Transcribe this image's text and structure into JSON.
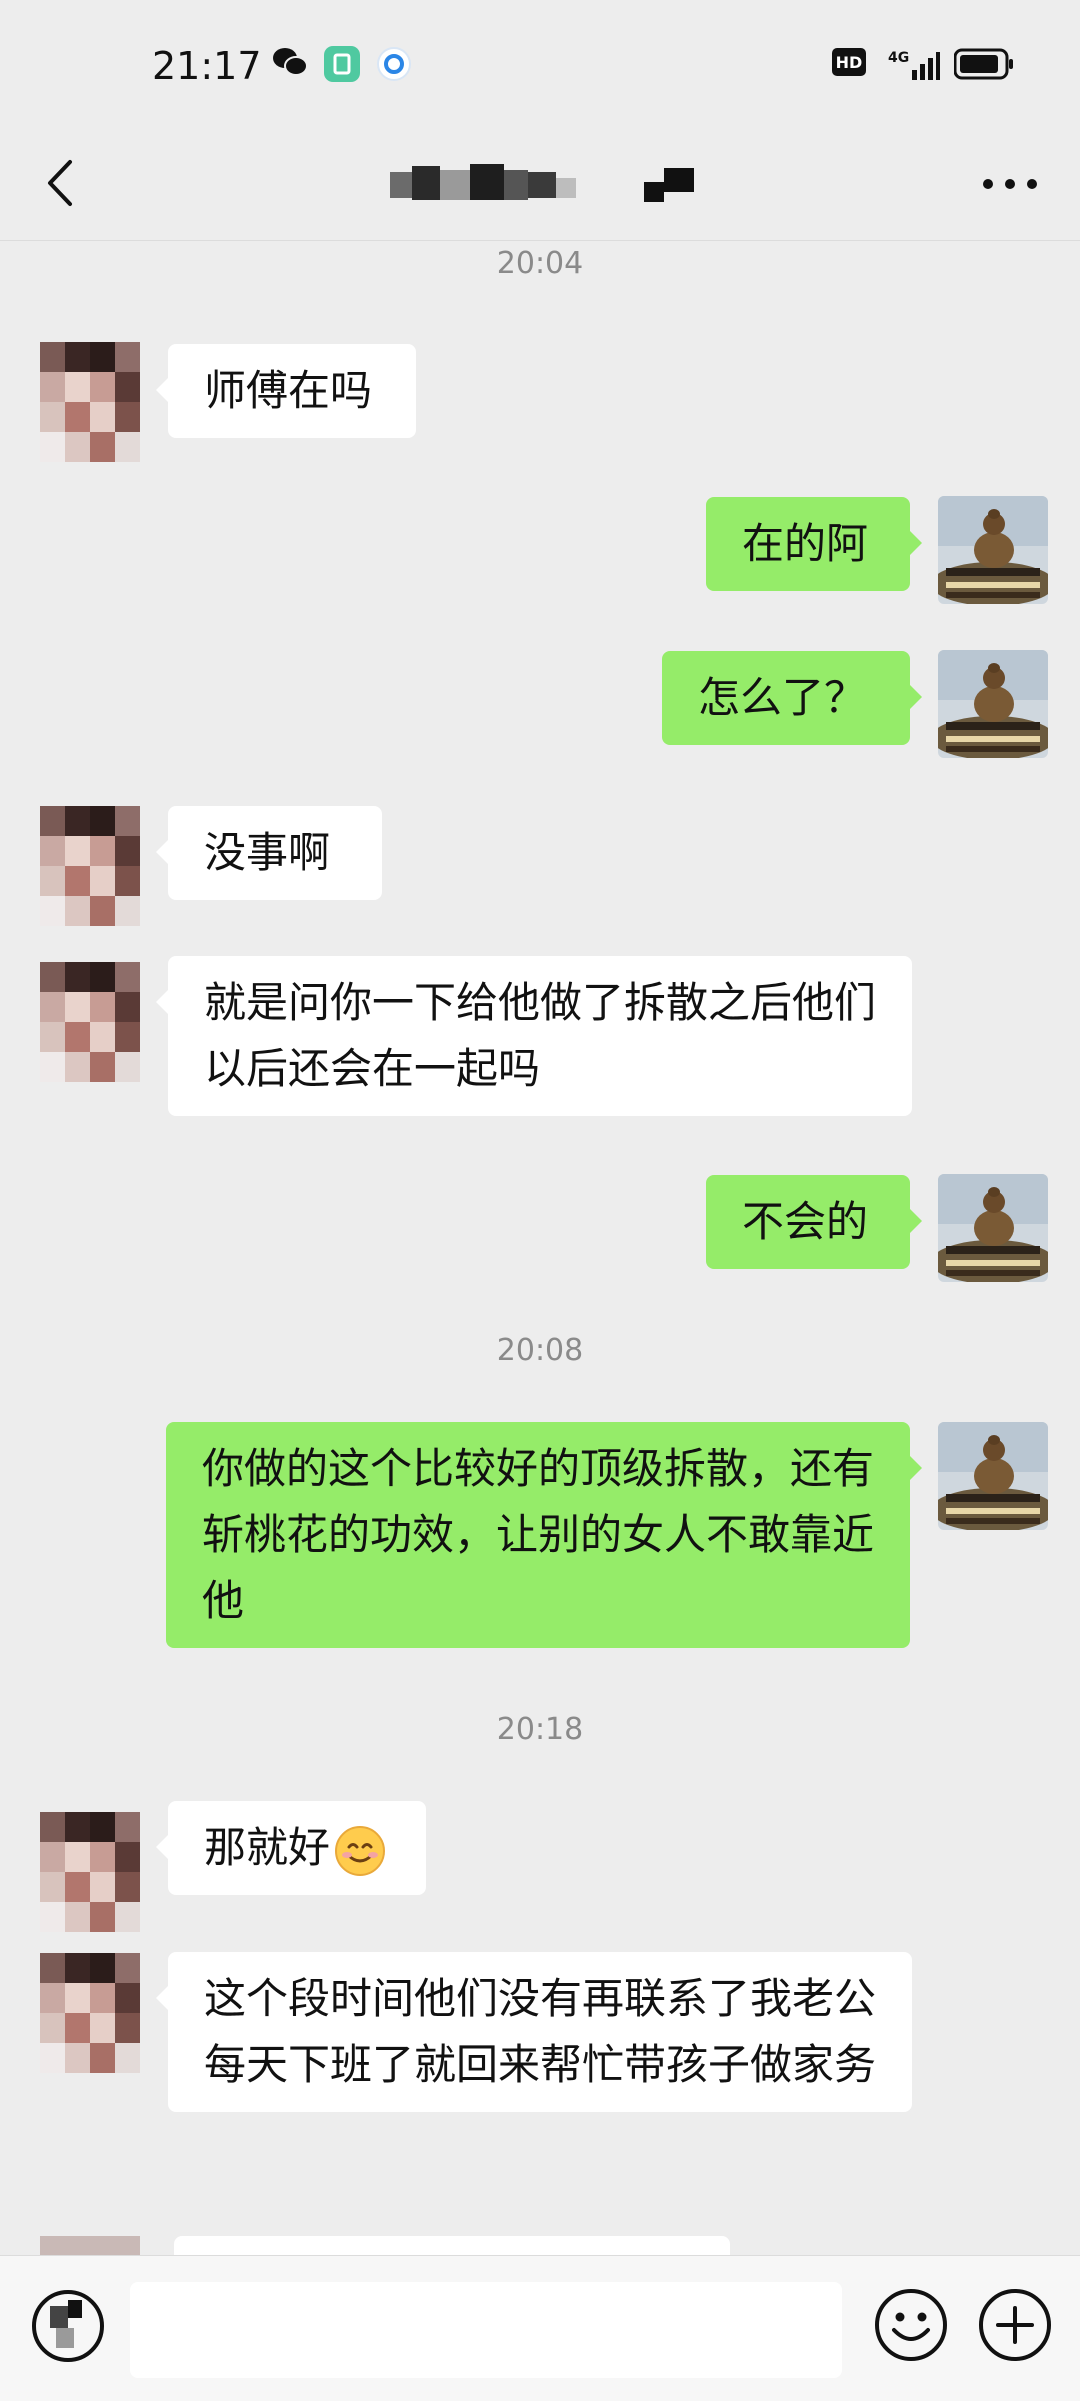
{
  "status_bar": {
    "time": "21:17",
    "network": "4G",
    "hd_label": "HD"
  },
  "nav": {
    "back_icon": "chevron-left-icon",
    "more_icon": "more-horizontal-icon"
  },
  "timestamps": [
    "20:04",
    "20:08",
    "20:18"
  ],
  "messages": [
    {
      "side": "left",
      "text": "师傅在吗"
    },
    {
      "side": "right",
      "text": "在的阿"
    },
    {
      "side": "right",
      "text": "怎么了？"
    },
    {
      "side": "left",
      "text": "没事啊"
    },
    {
      "side": "left",
      "text": "就是问你一下给他做了拆散之后他们以后还会在一起吗"
    },
    {
      "side": "right",
      "text": "不会的"
    },
    {
      "side": "right",
      "text": "你做的这个比较好的顶级拆散，还有斩桃花的功效，让别的女人不敢靠近他"
    },
    {
      "side": "left",
      "text": "那就好"
    },
    {
      "side": "left",
      "text": "这个段时间他们没有再联系了我老公每天下班了就回来帮忙带孩子做家务"
    }
  ],
  "input_bar": {
    "voice_icon": "voice-icon",
    "emoji_icon": "emoji-icon",
    "plus_icon": "plus-circle-icon"
  },
  "colors": {
    "background": "#ededed",
    "bubble_right": "#95ec69",
    "bubble_left": "#ffffff",
    "timestamp": "#8a8a8a"
  }
}
